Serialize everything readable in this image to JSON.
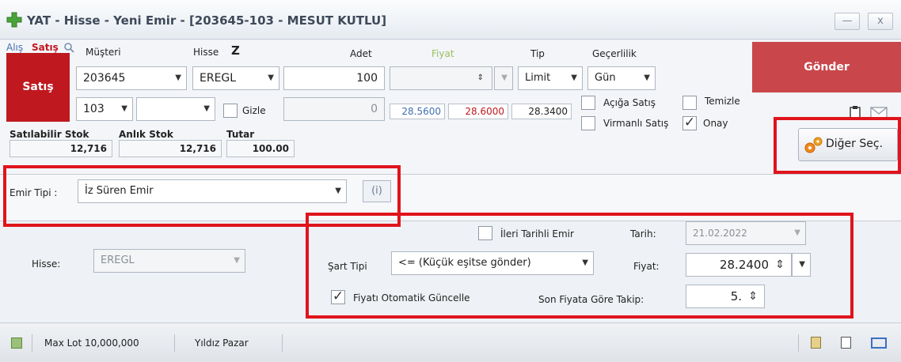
{
  "window": {
    "title": "YAT - Hisse - Yeni Emir - [203645-103 - MESUT KUTLU]",
    "minimize": "—",
    "close": "x"
  },
  "side": {
    "alis": "Alış",
    "satis_toggle": "Satış",
    "satis_button": "Satış"
  },
  "labels": {
    "musteri": "Müşteri",
    "hisse": "Hisse",
    "hisse_marker": "Z",
    "adet": "Adet",
    "fiyat": "Fiyat",
    "tip": "Tip",
    "gecerlilik": "Geçerlilik"
  },
  "fields": {
    "musteri_no": "203645",
    "hisse": "EREGL",
    "adet": "100",
    "hesap": "103",
    "gizli_adet": "0",
    "tip": "Limit",
    "gecerlilik": "Gün",
    "gizle": "Gizle",
    "price_low": "28.5600",
    "price_high": "28.6000",
    "price_last": "28.3400"
  },
  "options": {
    "aciga_satis": "Açığa Satış",
    "temizle": "Temizle",
    "virmanli_satis": "Virmanlı Satış",
    "onay": "Onay"
  },
  "stats": {
    "satilabilir_stok_label": "Satılabilir Stok",
    "anlik_stok_label": "Anlık Stok",
    "tutar_label": "Tutar",
    "satilabilir_stok": "12,716",
    "anlik_stok": "12,716",
    "tutar": "100.00"
  },
  "actions": {
    "gonder": "Gönder",
    "diger_sec": "Diğer Seç."
  },
  "emir": {
    "label": "Emir Tipi :",
    "value": "İz Süren Emir",
    "info": "(i)"
  },
  "trailing": {
    "hisse_label": "Hisse:",
    "hisse_value": "EREGL",
    "ileri_tarihli": "İleri Tarihli Emir",
    "tarih_label": "Tarih:",
    "tarih_value": "21.02.2022",
    "sart_tipi_label": "Şart Tipi",
    "sart_tipi_value": "<= (Küçük eşitse gönder)",
    "fiyat_label": "Fiyat:",
    "fiyat_value": "28.2400",
    "otomatik_guncelle": "Fiyatı Otomatik Güncelle",
    "son_fiyat_label": "Son Fiyata Göre Takip:",
    "son_fiyat_value": "5."
  },
  "status": {
    "max_lot": "Max Lot 10,000,000",
    "pazar": "Yıldız Pazar"
  },
  "colors": {
    "sell_red": "#c0181f",
    "send_red": "#c9474b",
    "highlight": "#e0141c"
  }
}
